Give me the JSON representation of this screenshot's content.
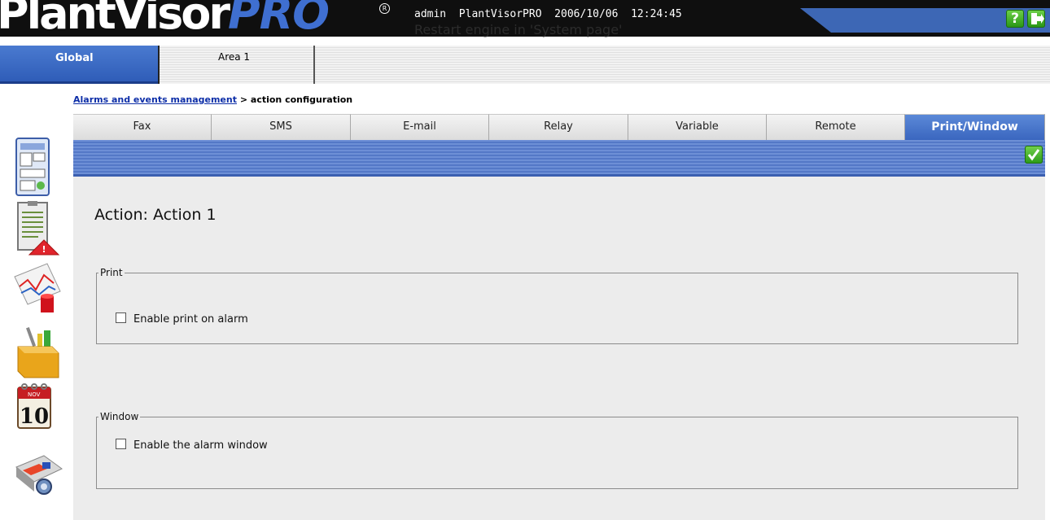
{
  "header": {
    "logo_main": "PlantVisor",
    "logo_pro": "PRO",
    "logo_reg": "R",
    "session_info": "admin  PlantVisorPRO  2006/10/06  12:24:45",
    "restart_message": "Restart engine in 'System page'",
    "help_icon": "help-icon",
    "logout_icon": "exit-icon"
  },
  "area_tabs": [
    {
      "label": "Global",
      "active": true
    },
    {
      "label": "Area 1",
      "active": false
    }
  ],
  "breadcrumb": {
    "link": "Alarms and events management",
    "separator": ">",
    "current": "action configuration"
  },
  "sidebar_icons": [
    "site-map-icon",
    "alarm-list-icon",
    "chart-report-icon",
    "tools-box-icon",
    "calendar-icon",
    "machine-plant-icon"
  ],
  "calendar_icon_text": {
    "month": "NOV",
    "day": "10"
  },
  "action_tabs": [
    {
      "label": "Fax",
      "active": false
    },
    {
      "label": "SMS",
      "active": false
    },
    {
      "label": "E-mail",
      "active": false
    },
    {
      "label": "Relay",
      "active": false
    },
    {
      "label": "Variable",
      "active": false
    },
    {
      "label": "Remote",
      "active": false
    },
    {
      "label": "Print/Window",
      "active": true
    }
  ],
  "confirm_icon": "checkmark-icon",
  "action_title": "Action: Action 1",
  "print_group": {
    "legend": "Print",
    "checkbox_label": "Enable print on alarm",
    "checked": false
  },
  "window_group": {
    "legend": "Window",
    "checkbox_label": "Enable the alarm window",
    "checked": false
  },
  "colors": {
    "header_bg": "#0f0f0f",
    "accent_blue": "#3d67b5",
    "panel_bg": "#ececec",
    "link": "#0e2fa8",
    "green_button": "#2a9a16"
  }
}
